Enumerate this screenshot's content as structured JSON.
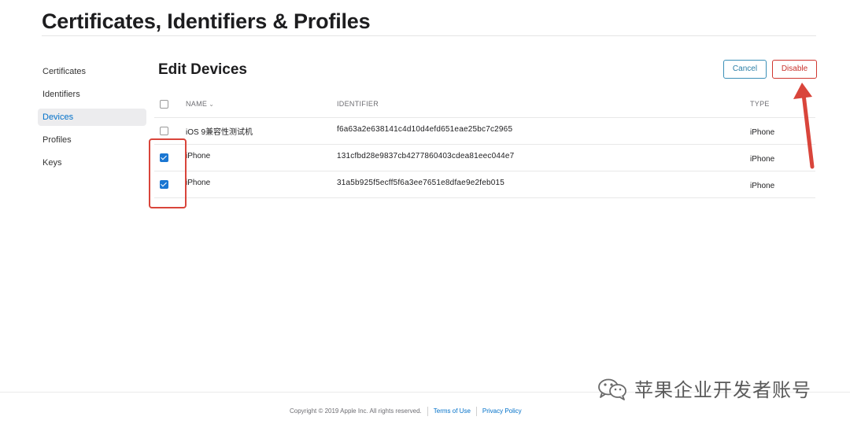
{
  "header": {
    "title": "Certificates, Identifiers & Profiles"
  },
  "sidebar": {
    "items": [
      {
        "label": "Certificates",
        "active": false
      },
      {
        "label": "Identifiers",
        "active": false
      },
      {
        "label": "Devices",
        "active": true
      },
      {
        "label": "Profiles",
        "active": false
      },
      {
        "label": "Keys",
        "active": false
      }
    ]
  },
  "main": {
    "section_title": "Edit Devices",
    "cancel_label": "Cancel",
    "disable_label": "Disable",
    "table": {
      "columns": {
        "name": "NAME",
        "identifier": "IDENTIFIER",
        "type": "TYPE"
      },
      "rows": [
        {
          "checked": false,
          "name": "iOS 9兼容性测试机",
          "identifier": "f6a63a2e638141c4d10d4efd651eae25bc7c2965",
          "type": "iPhone"
        },
        {
          "checked": true,
          "name": "iPhone",
          "identifier": "131cfbd28e9837cb4277860403cdea81eec044e7",
          "type": "iPhone"
        },
        {
          "checked": true,
          "name": "iPhone",
          "identifier": "31a5b925f5ecff5f6a3ee7651e8dfae9e2feb015",
          "type": "iPhone"
        }
      ]
    }
  },
  "footer": {
    "copyright": "Copyright © 2019 Apple Inc. All rights reserved.",
    "terms_label": "Terms of Use",
    "privacy_label": "Privacy Policy"
  },
  "watermark": {
    "text": "苹果企业开发者账号",
    "icon": "wechat-icon"
  },
  "colors": {
    "accent": "#0070c9",
    "danger": "#d0362f",
    "annotation": "#d9453b"
  }
}
